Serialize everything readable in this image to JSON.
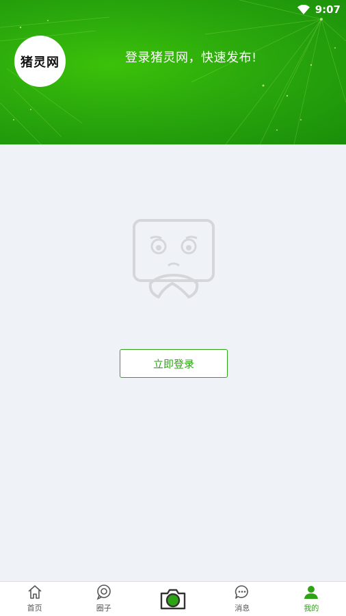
{
  "status_bar": {
    "time": "9:07",
    "wifi_icon": "wifi-icon"
  },
  "header": {
    "logo_text": "猪灵网",
    "title": "登录猪灵网，快速发布!"
  },
  "empty_state": {
    "illustration": "sad-face-empty-icon"
  },
  "login_button": {
    "label": "立即登录"
  },
  "colors": {
    "brand_green": "#2ea316",
    "header_green": "#2aa80c",
    "background": "#eff2f7"
  },
  "bottom_nav": {
    "items": [
      {
        "label": "首页",
        "icon": "home-icon"
      },
      {
        "label": "圈子",
        "icon": "circle-icon"
      },
      {
        "label": "",
        "icon": "camera-icon"
      },
      {
        "label": "消息",
        "icon": "message-icon"
      },
      {
        "label": "我的",
        "icon": "user-icon",
        "active": true
      }
    ]
  }
}
